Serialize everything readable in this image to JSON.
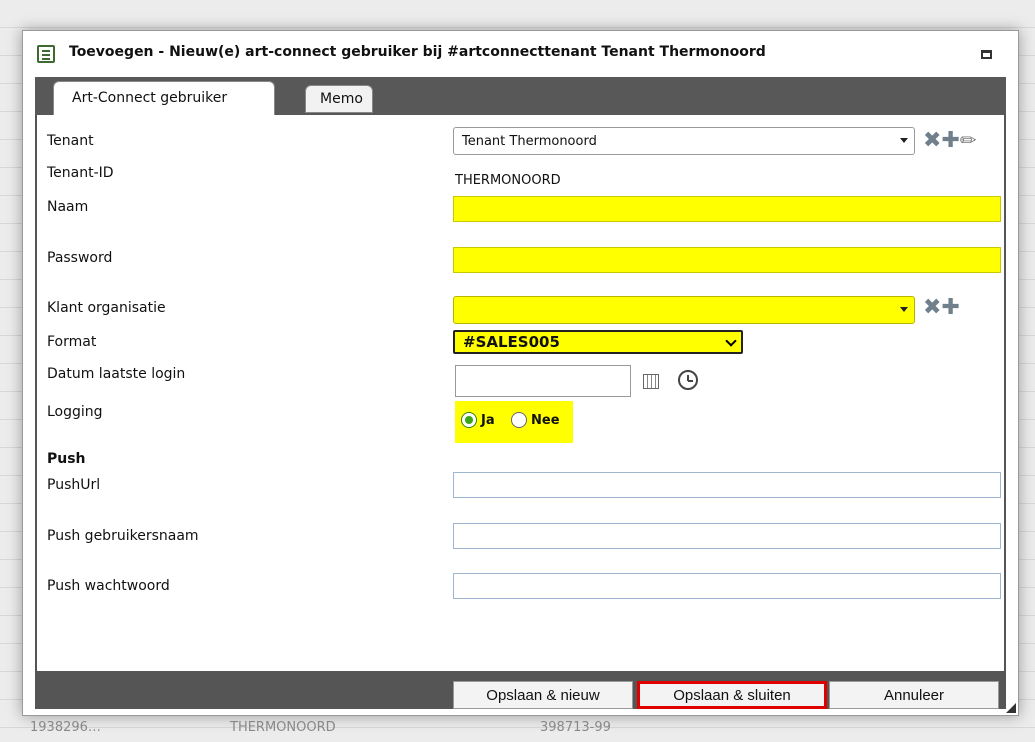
{
  "background": {
    "rows": [
      {
        "id": "1938296…",
        "code": "THERMONOORD",
        "num": "398713-99"
      }
    ]
  },
  "dialog": {
    "title": "Toevoegen - Nieuw(e) art-connect gebruiker bij #artconnecttenant Tenant Thermonoord"
  },
  "tabs": [
    {
      "label": "Art-Connect gebruiker",
      "active": true
    },
    {
      "label": "Memo",
      "active": false
    }
  ],
  "form": {
    "tenant_label": "Tenant",
    "tenant_value": "Tenant Thermonoord",
    "tenant_id_label": "Tenant-ID",
    "tenant_id_value": "THERMONOORD",
    "naam_label": "Naam",
    "naam_value": "",
    "password_label": "Password",
    "password_value": "",
    "klant_label": "Klant organisatie",
    "klant_value": "",
    "format_label": "Format",
    "format_value": "#SALES005",
    "datum_label": "Datum laatste login",
    "datum_value": "",
    "logging_label": "Logging",
    "logging_options": [
      "Ja",
      "Nee"
    ],
    "logging_selected": "Ja",
    "push_heading": "Push",
    "pushurl_label": "PushUrl",
    "pushurl_value": "",
    "push_user_label": "Push gebruikersnaam",
    "push_user_value": "",
    "push_pw_label": "Push wachtwoord",
    "push_pw_value": ""
  },
  "footer": {
    "save_new": "Opslaan & nieuw",
    "save_close": "Opslaan & sluiten",
    "cancel": "Annuleer"
  },
  "colors": {
    "required_yellow": "#ffff00",
    "highlight_red": "#e00000",
    "dark_bar": "#555555"
  }
}
